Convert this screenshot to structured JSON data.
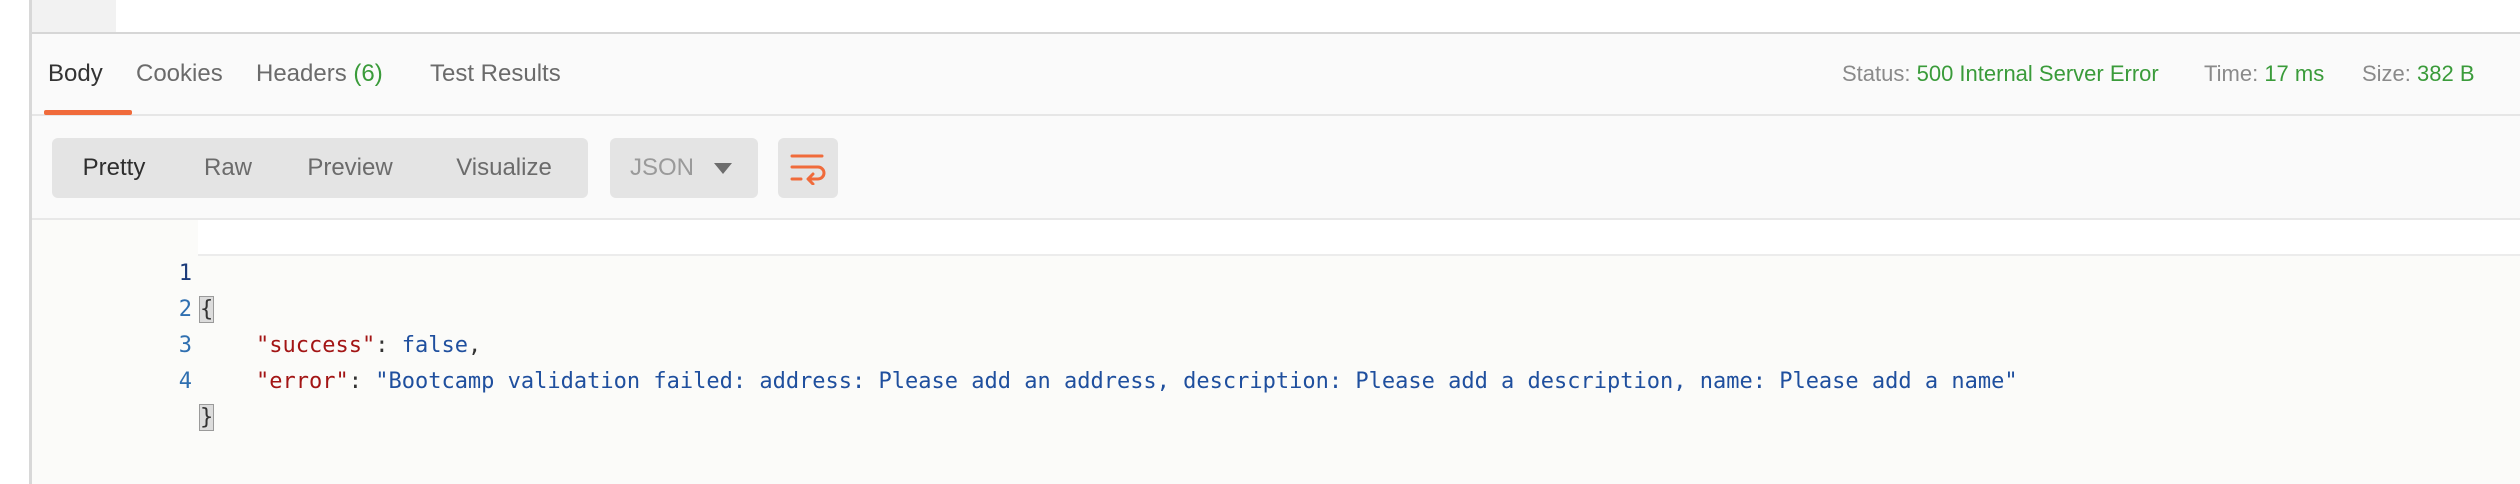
{
  "response_tabs": [
    {
      "label": "Body"
    },
    {
      "label": "Cookies"
    },
    {
      "label": "Headers",
      "count": "(6)"
    },
    {
      "label": "Test Results"
    }
  ],
  "status": {
    "status_label": "Status:",
    "status_value": "500 Internal Server Error",
    "time_label": "Time:",
    "time_value": "17 ms",
    "size_label": "Size:",
    "size_value": "382 B"
  },
  "view_modes": [
    "Pretty",
    "Raw",
    "Preview",
    "Visualize"
  ],
  "format": {
    "selected": "JSON"
  },
  "code": {
    "line_numbers": [
      "1",
      "2",
      "3",
      "4"
    ],
    "open_brace": "{",
    "close_brace": "}",
    "success_key": "\"success\"",
    "success_value": "false",
    "error_key": "\"error\"",
    "error_value": "\"Bootcamp validation failed: address: Please add an address, description: Please add a description, name: Please add a name\"",
    "colon": ": ",
    "comma": ","
  },
  "icons": {
    "view_dropdown": "chevron-down-icon",
    "wrap": "wrap-lines-icon"
  },
  "colors": {
    "accent": "#f06b3b",
    "success_green": "#3a9b3a",
    "json_key": "#a31515",
    "json_value": "#1f4f9e"
  }
}
